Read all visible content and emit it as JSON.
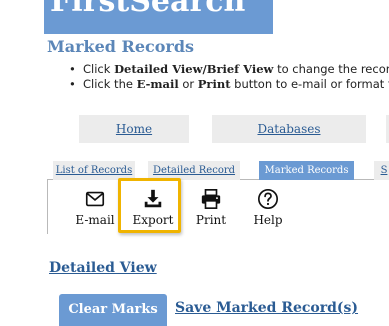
{
  "header": {
    "brand": "FirstSearch",
    "page_title": "Marked Records"
  },
  "instructions": [
    {
      "prefix": "Click ",
      "bold": "Detailed View/Brief View",
      "suffix": " to change the record f"
    },
    {
      "prefix": "Click the ",
      "bold1": "E-mail",
      "middle": " or ",
      "bold2": "Print",
      "suffix": " button to e-mail or format f"
    }
  ],
  "nav": {
    "home": "Home",
    "databases": "Databases"
  },
  "subtabs": {
    "list": "List of Records",
    "detailed": "Detailed Record",
    "marked": "Marked Records",
    "edge": "S"
  },
  "toolbar": {
    "email": {
      "label": "E-mail",
      "icon": "envelope-icon"
    },
    "export": {
      "label": "Export",
      "icon": "download-icon"
    },
    "print": {
      "label": "Print",
      "icon": "printer-icon"
    },
    "help": {
      "label": "Help",
      "icon": "help-icon"
    }
  },
  "actions": {
    "detailed_view": "Detailed View",
    "clear_marks": "Clear Marks",
    "save_marked": "Save Marked Record(s)"
  },
  "colors": {
    "accent": "#6b9ad3",
    "link": "#2a5b93",
    "highlight": "#f0b400"
  }
}
